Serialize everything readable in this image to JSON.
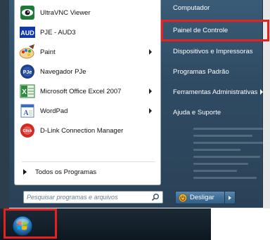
{
  "programs": [
    {
      "label": "UltraVNC Viewer",
      "icon": "eye-icon",
      "submenu": false
    },
    {
      "label": "PJE - AUD3",
      "icon": "aud-icon",
      "submenu": false
    },
    {
      "label": "Paint",
      "icon": "paint-icon",
      "submenu": true
    },
    {
      "label": "Navegador PJe",
      "icon": "pje-icon",
      "submenu": false
    },
    {
      "label": "Microsoft Office Excel 2007",
      "icon": "excel-icon",
      "submenu": true
    },
    {
      "label": "WordPad",
      "icon": "wordpad-icon",
      "submenu": true
    },
    {
      "label": "D-Link Connection Manager",
      "icon": "dlink-icon",
      "submenu": false
    }
  ],
  "all_programs_label": "Todos os Programas",
  "search": {
    "placeholder": "Pesquisar programas e arquivos"
  },
  "right_links": [
    {
      "label": "Computador",
      "submenu": false
    },
    {
      "label": "Painel de Controle",
      "submenu": false,
      "highlighted": true
    },
    {
      "label": "Dispositivos e Impressoras",
      "submenu": false
    },
    {
      "label": "Programas Padrão",
      "submenu": false
    },
    {
      "label": "Ferramentas Administrativas",
      "submenu": true
    },
    {
      "label": "Ajuda e Suporte",
      "submenu": false
    }
  ],
  "shutdown": {
    "label": "Desligar"
  },
  "icons": {
    "aud_text": "AUD",
    "pje_text": "PJe",
    "dlink_text": "Click"
  },
  "colors": {
    "highlight": "#e8201e",
    "menu_bg": "#2f4b63"
  }
}
